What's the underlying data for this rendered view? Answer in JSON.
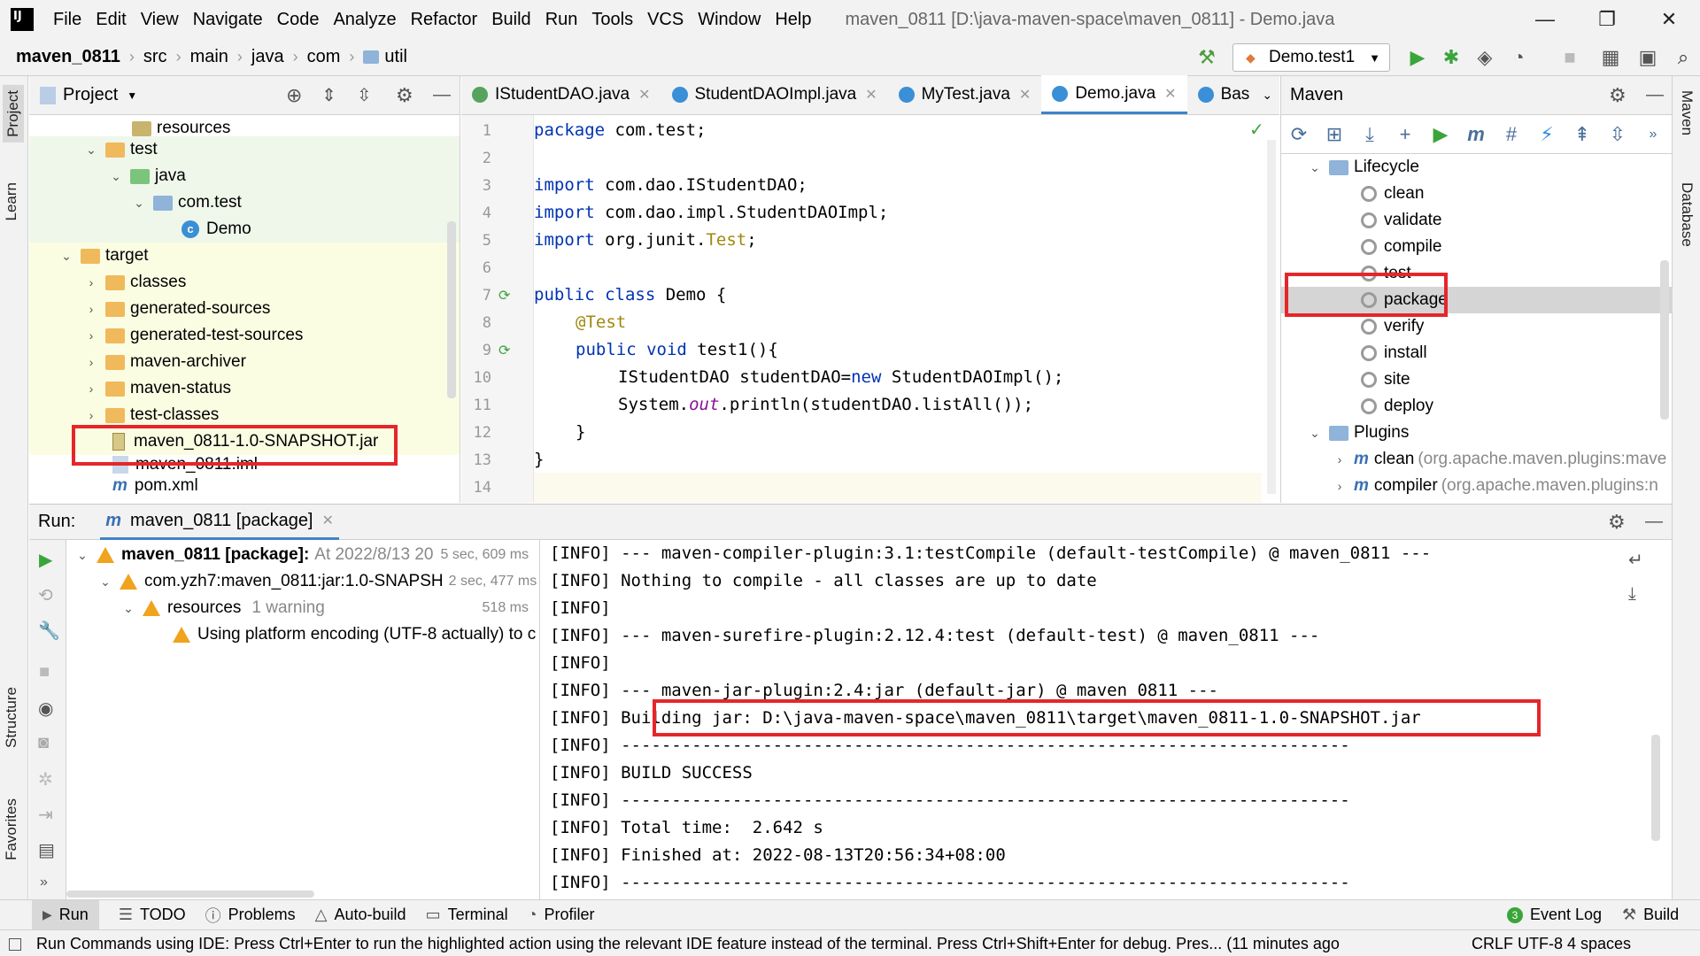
{
  "menubar": {
    "items": [
      "File",
      "Edit",
      "View",
      "Navigate",
      "Code",
      "Analyze",
      "Refactor",
      "Build",
      "Run",
      "Tools",
      "VCS",
      "Window",
      "Help"
    ],
    "title": "maven_0811 [D:\\java-maven-space\\maven_0811] - Demo.java"
  },
  "breadcrumb": {
    "items": [
      "maven_0811",
      "src",
      "main",
      "java",
      "com",
      "util"
    ]
  },
  "run_config": "Demo.test1",
  "project_panel": {
    "title": "Project",
    "rows": [
      {
        "label": "resources"
      },
      {
        "label": "test"
      },
      {
        "label": "java"
      },
      {
        "label": "com.test"
      },
      {
        "label": "Demo"
      },
      {
        "label": "target"
      },
      {
        "label": "classes"
      },
      {
        "label": "generated-sources"
      },
      {
        "label": "generated-test-sources"
      },
      {
        "label": "maven-archiver"
      },
      {
        "label": "maven-status"
      },
      {
        "label": "test-classes"
      },
      {
        "label": "maven_0811-1.0-SNAPSHOT.jar"
      },
      {
        "label": "maven_0811.iml"
      },
      {
        "label": "pom.xml"
      }
    ]
  },
  "editor": {
    "tabs": [
      "IStudentDAO.java",
      "StudentDAOImpl.java",
      "MyTest.java",
      "Demo.java",
      "Bas"
    ],
    "active_tab": "Demo.java",
    "line_numbers": [
      "1",
      "2",
      "3",
      "4",
      "5",
      "6",
      "7",
      "8",
      "9",
      "10",
      "11",
      "12",
      "13",
      "14"
    ],
    "lines": {
      "l1_kw": "package",
      "l1_rest": " com.test;",
      "l3_kw": "import",
      "l3_rest": " com.dao.IStudentDAO;",
      "l4_kw": "import",
      "l4_rest": " com.dao.impl.StudentDAOImpl;",
      "l5_kw": "import",
      "l5_rest": " org.junit.",
      "l5_an": "Test",
      "l5_end": ";",
      "l7_kw": "public class",
      "l7_rest": " Demo {",
      "l8_an": "@Test",
      "l9_kw": "public void",
      "l9_rest": " test1(){",
      "l10_a": "IStudentDAO studentDAO=",
      "l10_kw": "new",
      "l10_b": " StudentDAOImpl();",
      "l11_a": "System.",
      "l11_it": "out",
      "l11_b": ".println(studentDAO.listAll());",
      "l12": "}",
      "l13": "}"
    }
  },
  "maven_panel": {
    "title": "Maven",
    "lifecycle_label": "Lifecycle",
    "lifecycle": [
      "clean",
      "validate",
      "compile",
      "test",
      "package",
      "verify",
      "install",
      "site",
      "deploy"
    ],
    "plugins_label": "Plugins",
    "plugins": [
      {
        "name": "clean",
        "detail": "(org.apache.maven.plugins:mave"
      },
      {
        "name": "compiler",
        "detail": "(org.apache.maven.plugins:n"
      }
    ]
  },
  "run_panel": {
    "label": "Run:",
    "tab": "maven_0811 [package]",
    "tree": {
      "root": "maven_0811 [package]:",
      "root_detail": "At 2022/8/13 20",
      "root_time": "5 sec, 609 ms",
      "child": "com.yzh7:maven_0811:jar:1.0-SNAPSH",
      "child_time": "2 sec, 477 ms",
      "resources": "resources",
      "resources_warn": "1 warning",
      "resources_time": "518 ms",
      "warning_msg": "Using platform encoding (UTF-8 actually) to c"
    },
    "console": [
      "[INFO] --- maven-compiler-plugin:3.1:testCompile (default-testCompile) @ maven_0811 ---",
      "[INFO] Nothing to compile - all classes are up to date",
      "[INFO]",
      "[INFO] --- maven-surefire-plugin:2.12.4:test (default-test) @ maven_0811 ---",
      "[INFO]",
      "[INFO] --- maven-jar-plugin:2.4:jar (default-jar) @ maven_0811 ---",
      "[INFO] Building jar: D:\\java-maven-space\\maven_0811\\target\\maven_0811-1.0-SNAPSHOT.jar",
      "[INFO] ------------------------------------------------------------------------",
      "[INFO] BUILD SUCCESS",
      "[INFO] ------------------------------------------------------------------------",
      "[INFO] Total time:  2.642 s",
      "[INFO] Finished at: 2022-08-13T20:56:34+08:00",
      "[INFO] ------------------------------------------------------------------------"
    ]
  },
  "left_stripe": [
    "Project",
    "Learn",
    "Structure",
    "Favorites"
  ],
  "right_stripe": [
    "Maven",
    "Database"
  ],
  "bottom_tabs": [
    "Run",
    "TODO",
    "Problems",
    "Auto-build",
    "Terminal",
    "Profiler"
  ],
  "bottom_right": [
    "Event Log",
    "Build"
  ],
  "status": {
    "message": "Run Commands using IDE: Press Ctrl+Enter to run the highlighted action using the relevant IDE feature instead of the terminal. Press Ctrl+Shift+Enter for debug. Pres... (11 minutes ago",
    "right": "CRLF   UTF-8   4 spaces"
  },
  "colors": {
    "highlight": "#e5262b",
    "keyword": "#0033b3",
    "annotation": "#9e880d",
    "accent": "#4083c9"
  }
}
